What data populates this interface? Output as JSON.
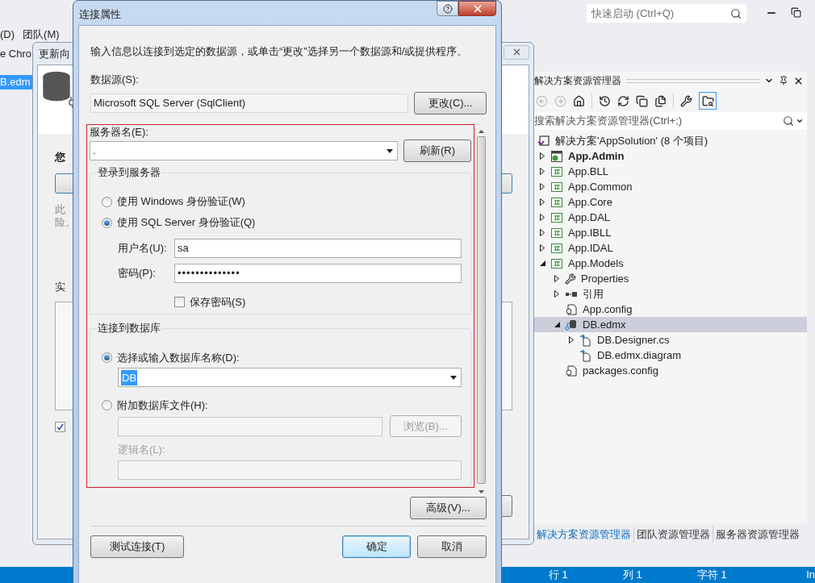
{
  "ide": {
    "menu": [
      {
        "label": "(D)"
      },
      {
        "label": "团队(M)"
      }
    ],
    "document_tab": "e Chro",
    "file_item": {
      "label": "B.edm",
      "selected": true
    },
    "quick_launch": {
      "placeholder": "快速启动 (Ctrl+Q)"
    }
  },
  "wizard": {
    "title": "更新向",
    "heading": "您",
    "note": [
      "此",
      "险。"
    ],
    "section_label": "实",
    "option": {
      "checked": true
    }
  },
  "dialog": {
    "title": "连接属性",
    "description": "输入信息以连接到选定的数据源，或单击“更改”选择另一个数据源和/或提供程序。",
    "data_source": {
      "label": "数据源(S):",
      "value": "Microsoft SQL Server (SqlClient)",
      "button": "更改(C)..."
    },
    "server": {
      "label": "服务器名(E):",
      "value": ".",
      "button": "刷新(R)"
    },
    "login": {
      "legend": "登录到服务器",
      "auth_options": [
        {
          "label": "使用 Windows 身份验证(W)",
          "selected": false
        },
        {
          "label": "使用 SQL Server 身份验证(Q)",
          "selected": true
        }
      ],
      "username": {
        "label": "用户名(U):",
        "value": "sa"
      },
      "password": {
        "label": "密码(P):",
        "value": "••••••••••••••"
      },
      "save_password": {
        "label": "保存密码(S)",
        "checked": false
      }
    },
    "database": {
      "legend": "连接到数据库",
      "options": [
        {
          "kind": "name",
          "label": "选择或输入数据库名称(D):",
          "selected": true,
          "value": "DB"
        },
        {
          "kind": "file",
          "label": "附加数据库文件(H):",
          "selected": false,
          "browse_button": "浏览(B)...",
          "logical_name_label": "逻辑名(L):"
        }
      ]
    },
    "advanced_button": "高级(V)...",
    "test_button": "测试连接(T)",
    "ok_button": "确定",
    "cancel_button": "取消"
  },
  "solution_explorer": {
    "title": "解决方案资源管理器",
    "search": {
      "placeholder": "搜索解决方案资源管理器(Ctrl+;)"
    },
    "tree": [
      {
        "label": "解决方案'AppSolution' (8 个项目)",
        "kind": "solution",
        "selected": false,
        "children": [
          {
            "label": "App.Admin",
            "kind": "web",
            "startup": true,
            "expanded": false,
            "selected": false
          },
          {
            "label": "App.BLL",
            "kind": "csharp",
            "startup": false,
            "expanded": false,
            "selected": false
          },
          {
            "label": "App.Common",
            "kind": "csharp",
            "startup": false,
            "expanded": false,
            "selected": false
          },
          {
            "label": "App.Core",
            "kind": "csharp",
            "startup": false,
            "expanded": false,
            "selected": false
          },
          {
            "label": "App.DAL",
            "kind": "csharp",
            "startup": false,
            "expanded": false,
            "selected": false
          },
          {
            "label": "App.IBLL",
            "kind": "csharp",
            "startup": false,
            "expanded": false,
            "selected": false
          },
          {
            "label": "App.IDAL",
            "kind": "csharp",
            "startup": false,
            "expanded": false,
            "selected": false
          },
          {
            "label": "App.Models",
            "kind": "csharp",
            "startup": false,
            "expanded": true,
            "selected": false,
            "children": [
              {
                "label": "Properties",
                "kind": "properties",
                "expanded": false,
                "selected": false
              },
              {
                "label": "引用",
                "kind": "references",
                "expanded": false,
                "selected": false
              },
              {
                "label": "App.config",
                "kind": "config",
                "selected": false
              },
              {
                "label": "DB.edmx",
                "kind": "edmx",
                "expanded": true,
                "selected": true,
                "children": [
                  {
                    "label": "DB.Designer.cs",
                    "kind": "code",
                    "expanded": false,
                    "selected": false
                  },
                  {
                    "label": "DB.edmx.diagram",
                    "kind": "code",
                    "selected": false
                  }
                ]
              },
              {
                "label": "packages.config",
                "kind": "config",
                "selected": false
              }
            ]
          }
        ]
      }
    ],
    "tabs": [
      {
        "label": "解决方案资源管理器",
        "selected": true
      },
      {
        "label": "团队资源管理器",
        "selected": false
      },
      {
        "label": "服务器资源管理器",
        "selected": false
      }
    ]
  },
  "status_bar": [
    "行 1",
    "列 1",
    "字符 1",
    "In"
  ]
}
